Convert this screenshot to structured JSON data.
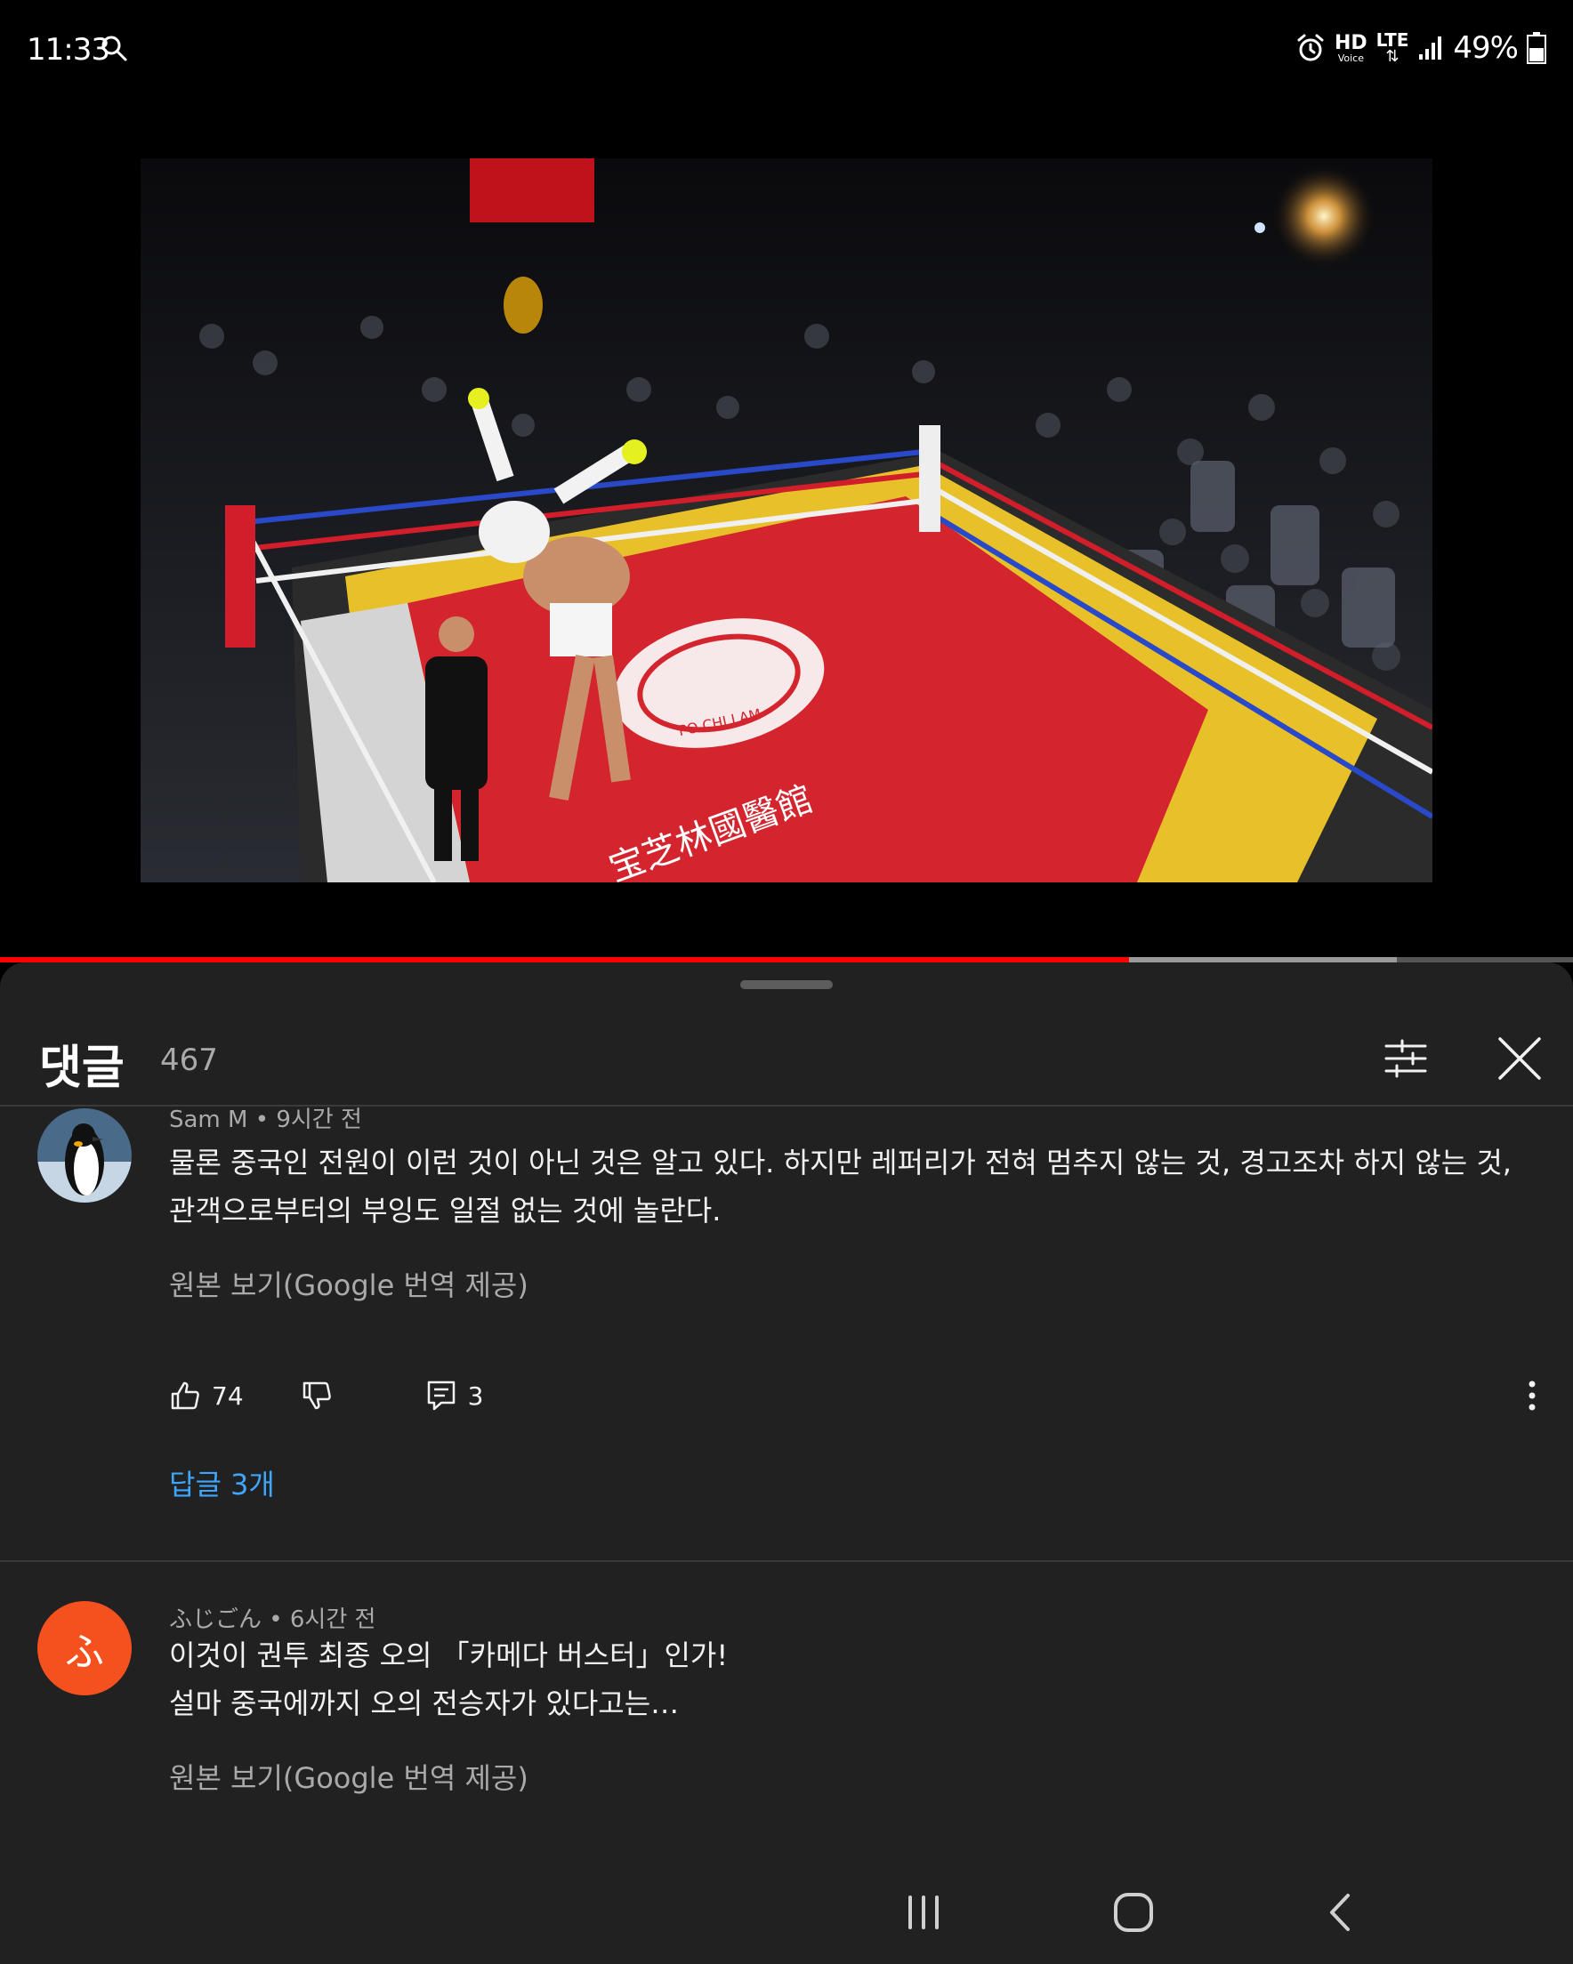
{
  "status_bar": {
    "time": "11:33",
    "hd_label": "HD",
    "voice_label": "Voice",
    "network": "LTE",
    "battery": "49%",
    "icons": [
      "search-icon",
      "alarm-icon",
      "signal-icon",
      "battery-icon"
    ]
  },
  "video": {
    "progress_played_pct": 71.8,
    "progress_buffered_pct": 88.8,
    "mat_logo_text": "PO CHI LAM",
    "mat_banner_text": "宝芝林國醫館"
  },
  "comments_panel": {
    "title": "댓글",
    "count": "467",
    "filter_icon": "sliders-icon",
    "close_icon": "close-icon"
  },
  "comments": [
    {
      "author": "Sam M",
      "time": "9시간 전",
      "text": "물론 중국인 전원이 이런 것이 아닌 것은 알고 있다. 하지만 레퍼리가 전혀 멈추지 않는 것, 경고조차 하지 않는 것,\n관객으로부터의 부잉도 일절 없는 것에 놀란다.",
      "translate_label": "원본 보기(Google 번역 제공)",
      "likes": "74",
      "reply_count": "3",
      "replies_label": "답글 3개",
      "avatar_icon": "penguin-avatar"
    },
    {
      "author": "ふじごん",
      "time": "6시간 전",
      "text": "이것이 권투 최종 오의 「카메다 버스터」인가!\n설마 중국에까지 오의 전승자가 있다고는…",
      "translate_label": "원본 보기(Google 번역 제공)",
      "avatar_letter": "ふ",
      "avatar_color": "#f4511e"
    }
  ],
  "nav_bar": {
    "icons": [
      "recent-apps-icon",
      "home-icon",
      "back-icon"
    ]
  },
  "colors": {
    "panel_bg": "#212121",
    "accent_red": "#ff0000",
    "link_blue": "#3ea6ff",
    "secondary_text": "#aaaaaa"
  }
}
